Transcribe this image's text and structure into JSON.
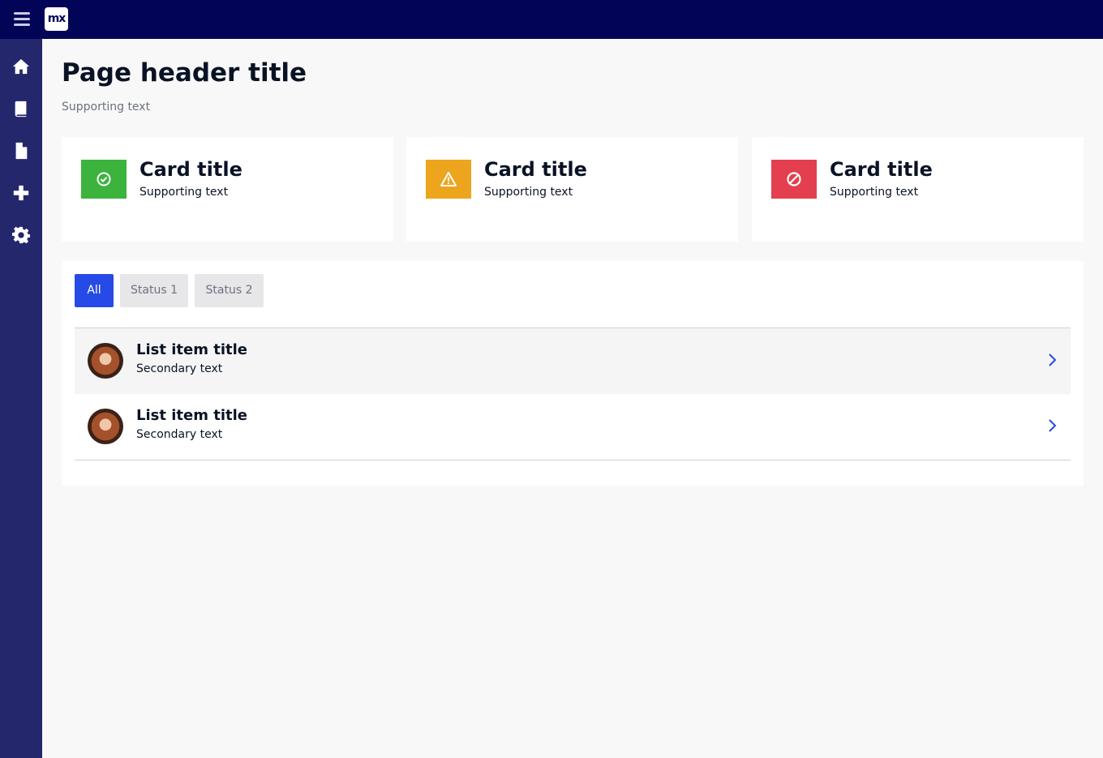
{
  "header": {
    "logo_text": "mx"
  },
  "sidebar": {
    "items": [
      {
        "icon": "home-icon"
      },
      {
        "icon": "book-icon"
      },
      {
        "icon": "file-icon"
      },
      {
        "icon": "plus-icon"
      },
      {
        "icon": "gear-icon"
      }
    ]
  },
  "page": {
    "title": "Page header title",
    "subtitle": "Supporting text"
  },
  "cards": [
    {
      "title": "Card title",
      "subtitle": "Supporting text",
      "icon": "check-circle-icon",
      "color": "#3cb33d"
    },
    {
      "title": "Card title",
      "subtitle": "Supporting text",
      "icon": "warning-icon",
      "color": "#eca51c"
    },
    {
      "title": "Card title",
      "subtitle": "Supporting text",
      "icon": "ban-icon",
      "color": "#e33f4e"
    }
  ],
  "tabs": [
    {
      "label": "All",
      "active": true
    },
    {
      "label": "Status 1",
      "active": false
    },
    {
      "label": "Status 2",
      "active": false
    }
  ],
  "list": [
    {
      "title": "List item title",
      "subtitle": "Secondary text"
    },
    {
      "title": "List item title",
      "subtitle": "Secondary text"
    }
  ],
  "colors": {
    "topbar": "#020557",
    "sidebar": "#24276c",
    "primary": "#264ae5",
    "background": "#f8f8f8"
  }
}
